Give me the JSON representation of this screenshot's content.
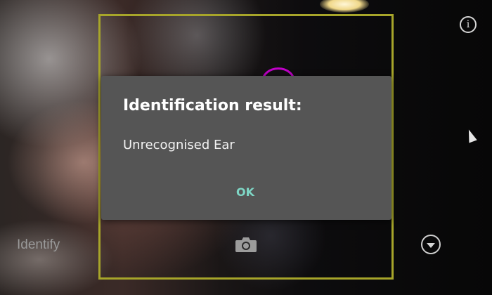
{
  "camera": {
    "frame_color": "#a7a52a"
  },
  "toolbar": {
    "identify_label": "Identify",
    "info_icon": "info-icon",
    "camera_icon": "camera-icon",
    "dropdown_icon": "chevron-down-circle-icon",
    "info_glyph": "i"
  },
  "dialog": {
    "title": "Identification result:",
    "message": "Unrecognised Ear",
    "ok_label": "OK",
    "accent_color": "#7ed6c5",
    "background_color": "#555555"
  }
}
